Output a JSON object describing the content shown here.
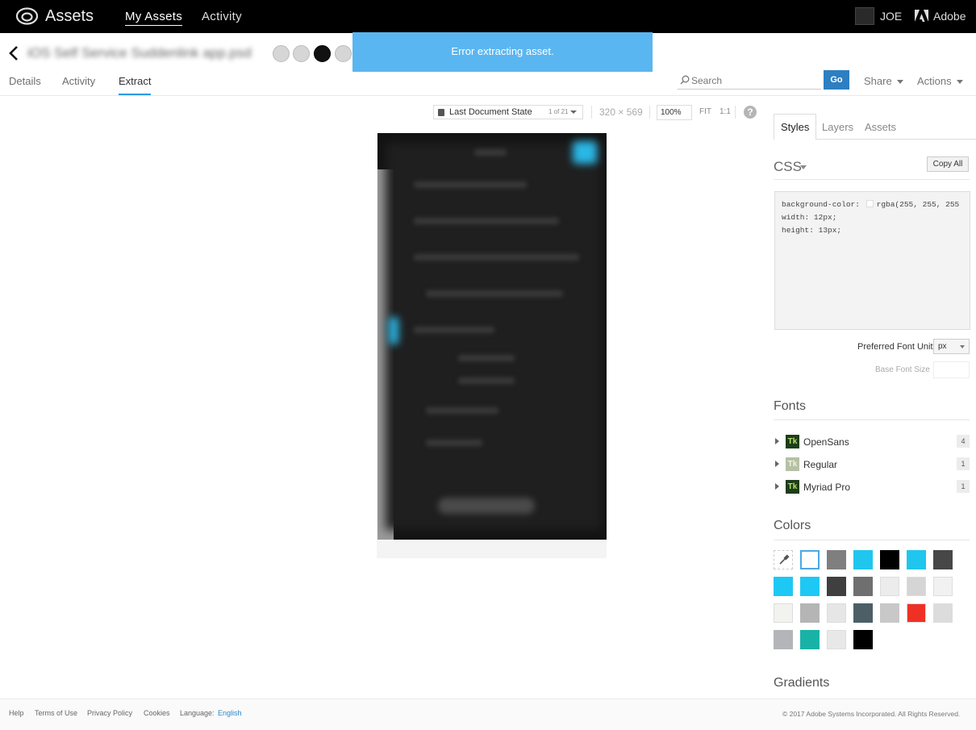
{
  "topbar": {
    "app_title": "Assets",
    "nav": [
      {
        "label": "My Assets",
        "active": true
      },
      {
        "label": "Activity",
        "active": false
      }
    ],
    "user_name": "JOE",
    "adobe_label": "Adobe"
  },
  "toast": {
    "message": "Error extracting asset."
  },
  "asset": {
    "title": "iOS Self Service Suddenlink app.psd",
    "tabs": [
      {
        "label": "Details"
      },
      {
        "label": "Activity"
      },
      {
        "label": "Extract",
        "active": true
      }
    ]
  },
  "header_actions": {
    "search_placeholder": "Search",
    "go_label": "Go",
    "share_label": "Share",
    "actions_label": "Actions"
  },
  "canvas_toolbar": {
    "state_label": "Last Document State",
    "state_count": "1 of 21",
    "dimensions": "320 × 569",
    "zoom": "100%",
    "fit_label": "FIT",
    "one_to_one_label": "1:1",
    "help_glyph": "?"
  },
  "panel": {
    "tabs": [
      {
        "label": "Styles",
        "active": true
      },
      {
        "label": "Layers"
      },
      {
        "label": "Assets"
      }
    ],
    "css": {
      "title": "CSS",
      "copy_all_label": "Copy All",
      "lines": [
        {
          "prop": "background-color:",
          "value": "rgba(255, 255, 255"
        },
        {
          "prop": "width:",
          "value": "12px;"
        },
        {
          "prop": "height:",
          "value": "13px;"
        }
      ]
    },
    "preferred_font_unit_label": "Preferred Font Unit",
    "preferred_font_unit_value": "px",
    "base_font_size_label": "Base Font Size",
    "fonts_title": "Fonts",
    "fonts": [
      {
        "name": "OpenSans",
        "count": "4",
        "icon": "Tk"
      },
      {
        "name": "Regular",
        "count": "1",
        "icon": "Tk"
      },
      {
        "name": "Myriad Pro",
        "count": "1",
        "icon": "Tk"
      }
    ],
    "colors_title": "Colors",
    "colors": [
      "#ffffff",
      "#7f7f7f",
      "#20c6ee",
      "#000000",
      "#20c6ee",
      "#474747",
      "#1ec8f4",
      "#1ec8f4",
      "#3f3f3f",
      "#6f6f6f",
      "#ececec",
      "#d5d5d5",
      "#f1f1f1",
      "#f2f2ee",
      "#b5b5b5",
      "#e6e6e6",
      "#4c5f66",
      "#c8c8c8",
      "#ee3124",
      "#dcdcdc",
      "#b4b5b8",
      "#18b3a6",
      "#e8e8e8",
      "#000000"
    ],
    "gradients_title": "Gradients"
  },
  "footer": {
    "help": "Help",
    "terms": "Terms of Use",
    "privacy": "Privacy Policy",
    "cookies": "Cookies",
    "language_label": "Language:",
    "language_value": "English",
    "copyright": "© 2017 Adobe Systems Incorporated. All Rights Reserved."
  }
}
